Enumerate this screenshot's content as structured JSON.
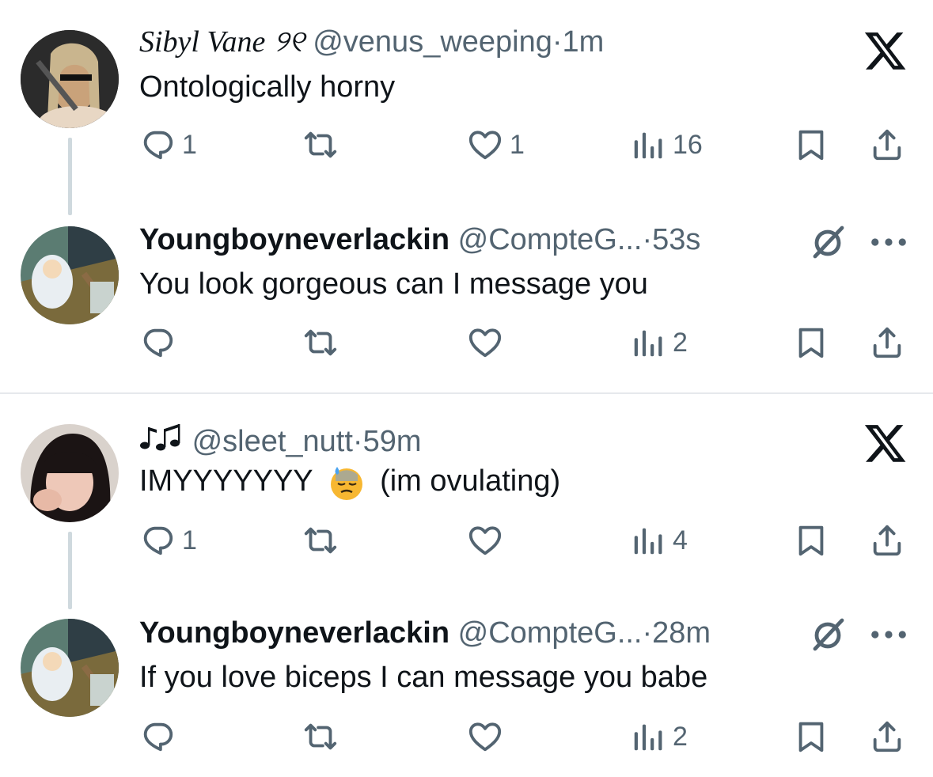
{
  "threads": [
    {
      "original": {
        "display_name": "Sibyl Vane",
        "name_glyph": "୨୧",
        "handle": "@venus_weeping",
        "separator": "·",
        "time": "1m",
        "text": "Ontologically horny",
        "replies": "1",
        "reposts": "",
        "likes": "1",
        "views": "16",
        "badge_icon": "x-logo-icon"
      },
      "reply": {
        "display_name": "Youngboyneverlackin",
        "handle": "@CompteG...",
        "separator": "·",
        "time": "53s",
        "text": "You look gorgeous can I message you",
        "replies": "",
        "reposts": "",
        "likes": "",
        "views": "2"
      }
    },
    {
      "original": {
        "display_name_icon": "musical-notes-icon",
        "handle": "@sleet_nutt",
        "separator": "·",
        "time": "59m",
        "text_before": "IMYYYYYYY",
        "emoji": "downcast-face-with-sweat-emoji",
        "text_after": "(im ovulating)",
        "replies": "1",
        "reposts": "",
        "likes": "",
        "views": "4",
        "badge_icon": "x-logo-icon"
      },
      "reply": {
        "display_name": "Youngboyneverlackin",
        "handle": "@CompteG...",
        "separator": "·",
        "time": "28m",
        "text": "If you love biceps I can message you babe",
        "replies": "",
        "reposts": "",
        "likes": "",
        "views": "2"
      }
    }
  ],
  "colors": {
    "text": "#0f1419",
    "muted": "#536471",
    "thread_line": "#cfd9de",
    "divider": "#e6e9ec"
  }
}
